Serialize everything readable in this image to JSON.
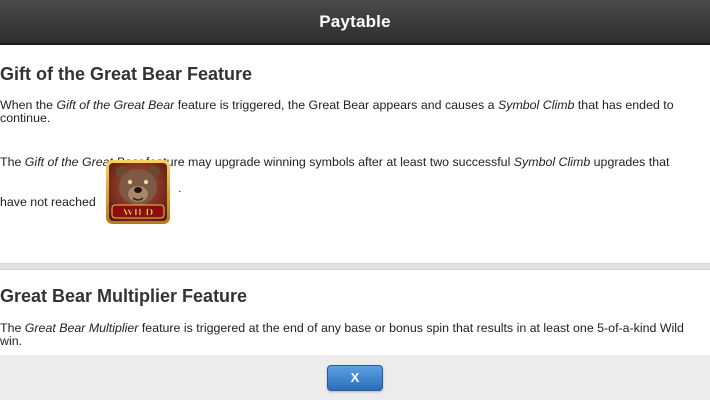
{
  "header": {
    "title": "Paytable"
  },
  "sections": [
    {
      "heading": "Gift of the Great Bear Feature",
      "p1": {
        "a": "When the ",
        "b": "Gift of the Great Bear",
        "c": " feature is triggered, the Great Bear appears and causes a ",
        "d": "Symbol Climb",
        "e": " that has ended to continue."
      },
      "p2": {
        "a": "The ",
        "b": "Gift of the Great Bear",
        "c": " feature may upgrade winning symbols after at least two successful ",
        "d": "Symbol Climb",
        "e": " upgrades that have not reached"
      },
      "trailing": ".",
      "wild_label": "WILD"
    },
    {
      "heading": "Great Bear Multiplier Feature",
      "p1": {
        "a": "The ",
        "b": "Great Bear Multiplier",
        "c": " feature is triggered at the end of any base or bonus spin that results in at least one 5-of-a-kind Wild win."
      }
    }
  ],
  "footer": {
    "close_label": "X"
  }
}
